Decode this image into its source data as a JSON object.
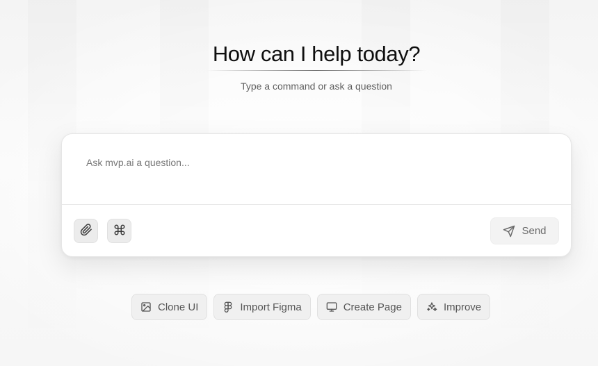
{
  "header": {
    "title": "How can I help today?",
    "subtitle": "Type a command or ask a question"
  },
  "composer": {
    "placeholder": "Ask mvp.ai a question...",
    "send_label": "Send",
    "attach_icon": "paperclip-icon",
    "command_icon": "command-icon"
  },
  "actions": [
    {
      "label": "Clone UI",
      "icon": "image-icon"
    },
    {
      "label": "Import Figma",
      "icon": "figma-icon"
    },
    {
      "label": "Create Page",
      "icon": "monitor-icon"
    },
    {
      "label": "Improve",
      "icon": "sparkles-icon"
    }
  ],
  "colors": {
    "title": "#0f0f0f",
    "subtitle": "#5f5f5f",
    "chip_background": "#f0f0f0",
    "send_text": "#6a6a6a"
  }
}
